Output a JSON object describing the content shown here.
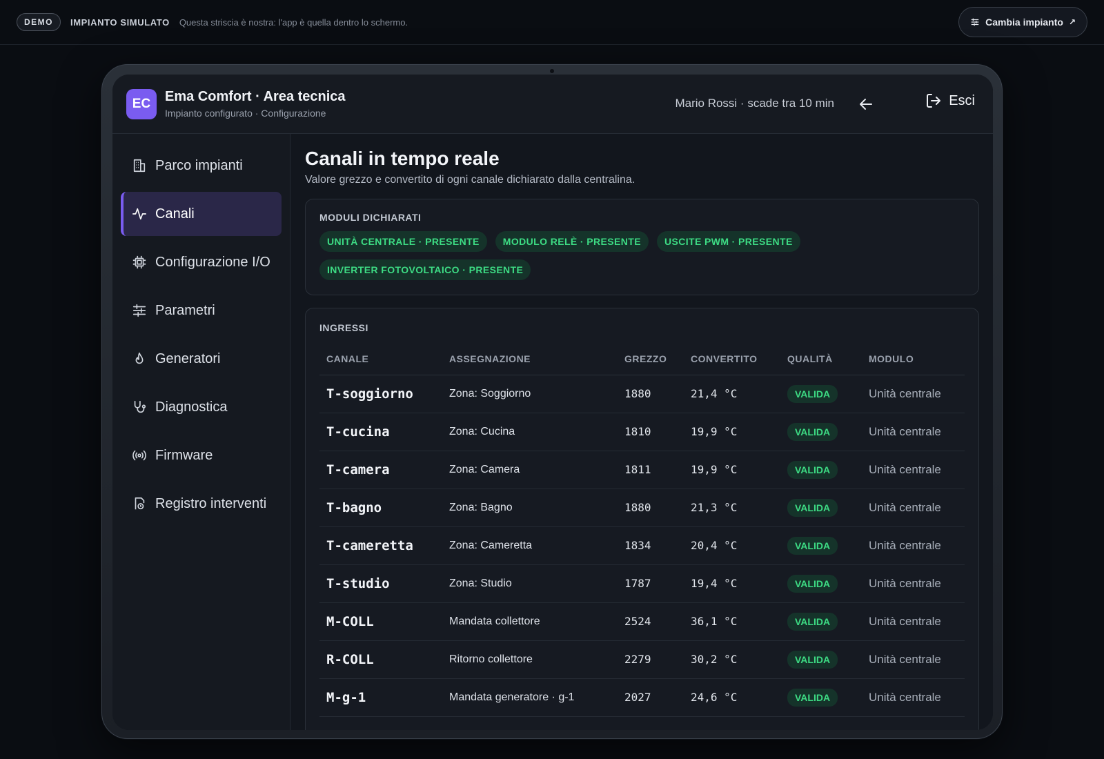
{
  "topbar": {
    "demo": "DEMO",
    "simulated": "IMPIANTO SIMULATO",
    "note": "Questa striscia è nostra: l'app è quella dentro lo schermo.",
    "change_button": "Cambia impianto"
  },
  "header": {
    "logo": "EC",
    "title": "Ema Comfort · Area tecnica",
    "subtitle": "Impianto configurato · Configurazione",
    "user": "Mario Rossi · scade tra 10 min",
    "logout": "Esci"
  },
  "sidebar": {
    "items": [
      {
        "label": "Parco impianti",
        "icon": "building-icon"
      },
      {
        "label": "Canali",
        "icon": "activity-icon",
        "active": true
      },
      {
        "label": "Configurazione I/O",
        "icon": "cpu-icon"
      },
      {
        "label": "Parametri",
        "icon": "sliders-icon"
      },
      {
        "label": "Generatori",
        "icon": "flame-icon"
      },
      {
        "label": "Diagnostica",
        "icon": "stethoscope-icon"
      },
      {
        "label": "Firmware",
        "icon": "radio-icon"
      },
      {
        "label": "Registro interventi",
        "icon": "file-clock-icon"
      }
    ]
  },
  "main": {
    "title": "Canali in tempo reale",
    "subtitle": "Valore grezzo e convertito di ogni canale dichiarato dalla centralina.",
    "modules": {
      "heading": "MODULI DICHIARATI",
      "chips": [
        "UNITÀ CENTRALE · PRESENTE",
        "MODULO RELÈ · PRESENTE",
        "USCITE PWM · PRESENTE",
        "INVERTER FOTOVOLTAICO · PRESENTE"
      ]
    },
    "inputs": {
      "heading": "INGRESSI",
      "columns": [
        "CANALE",
        "ASSEGNAZIONE",
        "GREZZO",
        "CONVERTITO",
        "QUALITÀ",
        "MODULO"
      ],
      "rows": [
        {
          "channel": "T-soggiorno",
          "assignment": "Zona: Soggiorno",
          "raw": "1880",
          "converted": "21,4 °C",
          "quality": "VALIDA",
          "module": "Unità centrale"
        },
        {
          "channel": "T-cucina",
          "assignment": "Zona: Cucina",
          "raw": "1810",
          "converted": "19,9 °C",
          "quality": "VALIDA",
          "module": "Unità centrale"
        },
        {
          "channel": "T-camera",
          "assignment": "Zona: Camera",
          "raw": "1811",
          "converted": "19,9 °C",
          "quality": "VALIDA",
          "module": "Unità centrale"
        },
        {
          "channel": "T-bagno",
          "assignment": "Zona: Bagno",
          "raw": "1880",
          "converted": "21,3 °C",
          "quality": "VALIDA",
          "module": "Unità centrale"
        },
        {
          "channel": "T-cameretta",
          "assignment": "Zona: Cameretta",
          "raw": "1834",
          "converted": "20,4 °C",
          "quality": "VALIDA",
          "module": "Unità centrale"
        },
        {
          "channel": "T-studio",
          "assignment": "Zona: Studio",
          "raw": "1787",
          "converted": "19,4 °C",
          "quality": "VALIDA",
          "module": "Unità centrale"
        },
        {
          "channel": "M-COLL",
          "assignment": "Mandata collettore",
          "raw": "2524",
          "converted": "36,1 °C",
          "quality": "VALIDA",
          "module": "Unità centrale"
        },
        {
          "channel": "R-COLL",
          "assignment": "Ritorno collettore",
          "raw": "2279",
          "converted": "30,2 °C",
          "quality": "VALIDA",
          "module": "Unità centrale"
        },
        {
          "channel": "M-g-1",
          "assignment": "Mandata generatore · g-1",
          "raw": "2027",
          "converted": "24,6 °C",
          "quality": "VALIDA",
          "module": "Unità centrale"
        }
      ]
    }
  }
}
